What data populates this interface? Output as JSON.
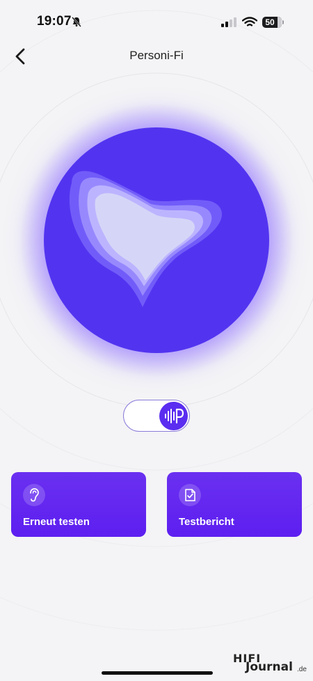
{
  "status_bar": {
    "time": "19:07",
    "battery": "50"
  },
  "header": {
    "title": "Personi-Fi"
  },
  "toggle": {
    "knob_icon": "personi-fi-wave-icon"
  },
  "cards": [
    {
      "label": "Erneut testen",
      "icon": "ear-icon"
    },
    {
      "label": "Testbericht",
      "icon": "document-check-icon"
    }
  ],
  "watermark": {
    "line1": "HIFI",
    "line2": "Journal",
    "suffix": ".de"
  },
  "colors": {
    "accent": "#5b2df0",
    "orb": "#5234f0",
    "card": "#6128f0",
    "background": "#f4f4f6"
  }
}
